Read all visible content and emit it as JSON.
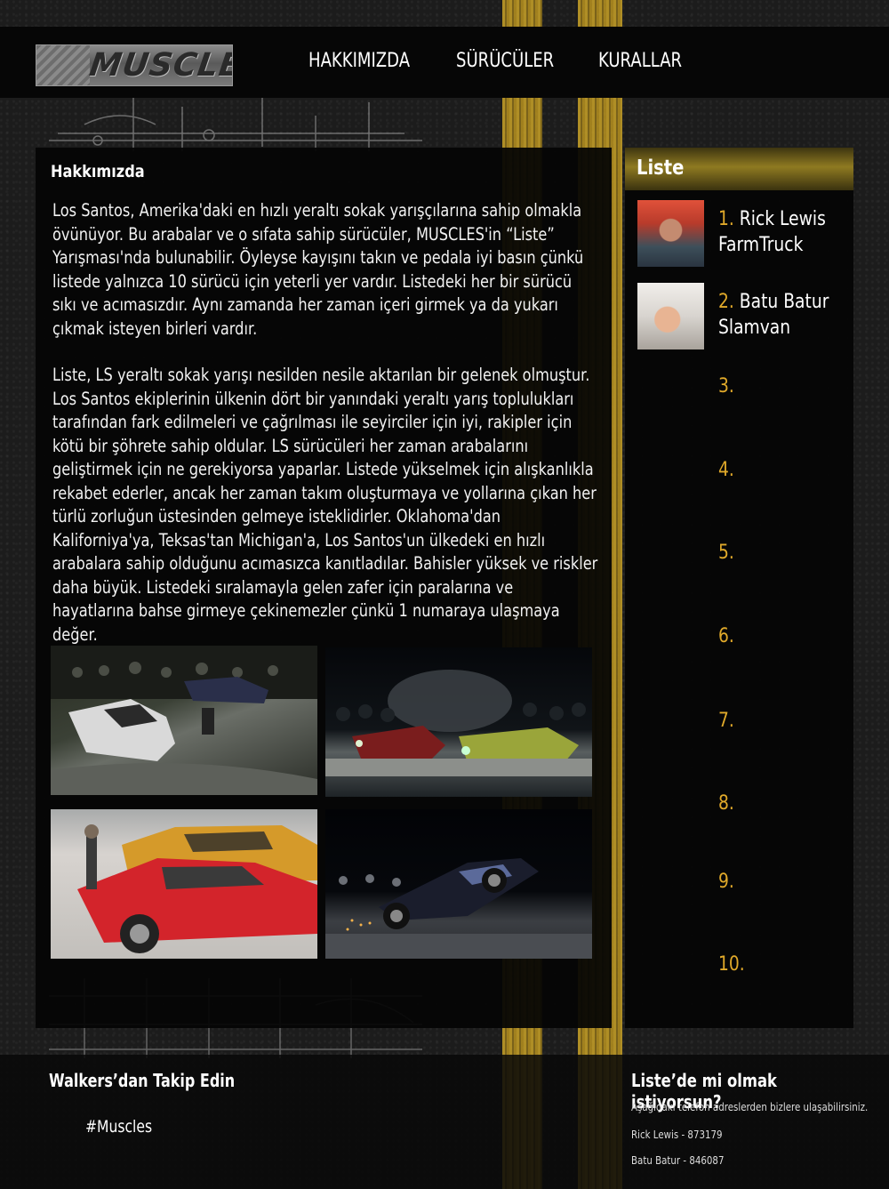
{
  "header": {
    "logo_text": "MUSCLES",
    "nav": [
      "HAKKIMIZDA",
      "SÜRÜCÜLER",
      "KURALLAR"
    ]
  },
  "main": {
    "title": "Hakkımızda",
    "paragraphs": [
      "Los Santos, Amerika'daki en hızlı yeraltı sokak yarışçılarına sahip olmakla övünüyor. Bu arabalar ve o sıfata sahip sürücüler, MUSCLES'in “Liste” Yarışması'nda bulunabilir. Öyleyse kayışını takın ve pedala iyi basın çünkü listede yalnızca 10 sürücü için yeterli yer vardır. Listedeki her bir sürücü sıkı ve acımasızdır. Aynı zamanda her zaman içeri girmek ya da yukarı çıkmak isteyen birleri vardır.",
      "Liste, LS yeraltı sokak yarışı nesilden nesile aktarılan bir gelenek olmuştur. Los Santos ekiplerinin ülkenin dört bir yanındaki yeraltı yarış toplulukları tarafından fark edilmeleri ve çağrılması ile seyirciler için iyi, rakipler için kötü bir şöhrete sahip oldular. LS sürücüleri her zaman arabalarını geliştirmek için ne gerekiyorsa yaparlar. Listede yükselmek için alışkanlıkla rekabet ederler, ancak her zaman takım oluşturmaya ve yollarına çıkan her türlü zorluğun üstesinden gelmeye isteklidirler. Oklahoma'dan Kaliforniya'ya, Teksas'tan Michigan'a, Los Santos'un ülkedeki en hızlı arabalara sahip olduğunu acımasızca kanıtladılar. Bahisler yüksek ve riskler daha büyük. Listedeki sıralamayla gelen zafer için paralarına ve hayatlarına bahse girmeye çekinemezler çünkü 1 numaraya ulaşmaya değer."
    ]
  },
  "sidebar": {
    "title": "Liste",
    "ranks": [
      {
        "num": "1.",
        "line1": "Rick Lewis",
        "line2": "FarmTruck"
      },
      {
        "num": "2.",
        "line1": "Batu Batur",
        "line2": "Slamvan"
      },
      {
        "num": "3."
      },
      {
        "num": "4."
      },
      {
        "num": "5."
      },
      {
        "num": "6."
      },
      {
        "num": "7."
      },
      {
        "num": "8."
      },
      {
        "num": "9."
      },
      {
        "num": "10."
      }
    ]
  },
  "footer": {
    "left_title": "Walkers’dan Takip Edin",
    "hashtag": "#Muscles",
    "right_title": "Liste’de mi olmak istiyorsun?",
    "info": "Aşağıdaki telefon adreslerden bizlere ulaşabilirsiniz.",
    "contact1": "Rick Lewis - 873179",
    "contact2": "Batu Batur - 846087"
  },
  "colors": {
    "accent": "#e0a92a",
    "lane": "#c9a227",
    "panel": "#040404"
  }
}
